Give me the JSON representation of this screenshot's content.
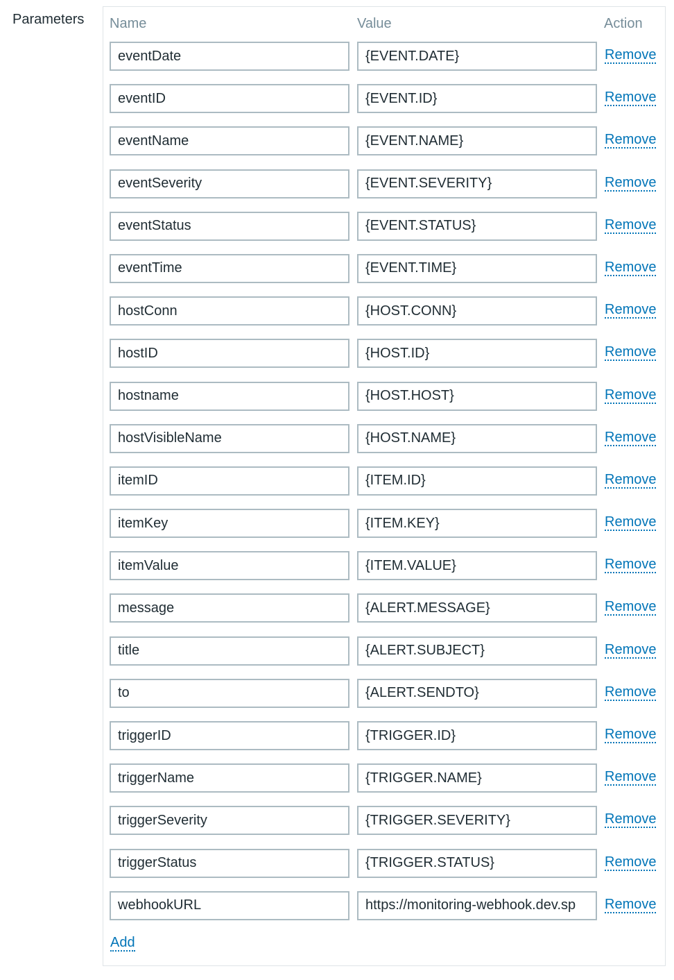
{
  "section_label": "Parameters",
  "headers": {
    "name": "Name",
    "value": "Value",
    "action": "Action"
  },
  "remove_label": "Remove",
  "add_label": "Add",
  "colors": {
    "link": "#0275b8",
    "header_text": "#768d99",
    "field_border": "#acbbc2"
  },
  "parameters": [
    {
      "name": "eventDate",
      "value": "{EVENT.DATE}"
    },
    {
      "name": "eventID",
      "value": "{EVENT.ID}"
    },
    {
      "name": "eventName",
      "value": "{EVENT.NAME}"
    },
    {
      "name": "eventSeverity",
      "value": "{EVENT.SEVERITY}"
    },
    {
      "name": "eventStatus",
      "value": "{EVENT.STATUS}"
    },
    {
      "name": "eventTime",
      "value": "{EVENT.TIME}"
    },
    {
      "name": "hostConn",
      "value": "{HOST.CONN}"
    },
    {
      "name": "hostID",
      "value": "{HOST.ID}"
    },
    {
      "name": "hostname",
      "value": "{HOST.HOST}"
    },
    {
      "name": "hostVisibleName",
      "value": "{HOST.NAME}"
    },
    {
      "name": "itemID",
      "value": "{ITEM.ID}"
    },
    {
      "name": "itemKey",
      "value": "{ITEM.KEY}"
    },
    {
      "name": "itemValue",
      "value": "{ITEM.VALUE}"
    },
    {
      "name": "message",
      "value": "{ALERT.MESSAGE}"
    },
    {
      "name": "title",
      "value": "{ALERT.SUBJECT}"
    },
    {
      "name": "to",
      "value": "{ALERT.SENDTO}"
    },
    {
      "name": "triggerID",
      "value": "{TRIGGER.ID}"
    },
    {
      "name": "triggerName",
      "value": "{TRIGGER.NAME}"
    },
    {
      "name": "triggerSeverity",
      "value": "{TRIGGER.SEVERITY}"
    },
    {
      "name": "triggerStatus",
      "value": "{TRIGGER.STATUS}"
    },
    {
      "name": "webhookURL",
      "value": "https://monitoring-webhook.dev.sp"
    }
  ]
}
